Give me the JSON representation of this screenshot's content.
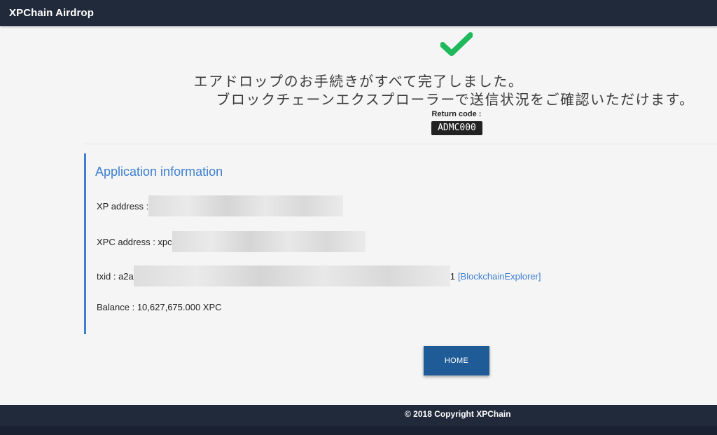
{
  "app": {
    "title": "XPChain Airdrop"
  },
  "status": {
    "icon": "checkmark-icon",
    "message_line1": "エアドロップのお手続きがすべて完了しました。",
    "message_line2": "ブロックチェーンエクスプローラーで送信状況をご確認いただけます。",
    "return_code_label": "Return code :",
    "return_code_value": "ADMC000"
  },
  "application": {
    "title": "Application information",
    "xp_address_label": "XP address : ",
    "xp_address_value": "",
    "xpc_address_label": "XPC address : xpc",
    "xpc_address_value": "",
    "txid_label": "txid : a2a",
    "txid_tail": "1",
    "explorer_link": "[BlockchainExplorer]",
    "balance_label": "Balance : 10,627,675.000 XPC"
  },
  "actions": {
    "home_label": "HOME"
  },
  "footer": {
    "copyright": "© 2018 Copyright XPChain"
  },
  "colors": {
    "navbar": "#212a3b",
    "accent": "#3d7fd0",
    "button": "#1f5b96",
    "success": "#1fb85a"
  }
}
